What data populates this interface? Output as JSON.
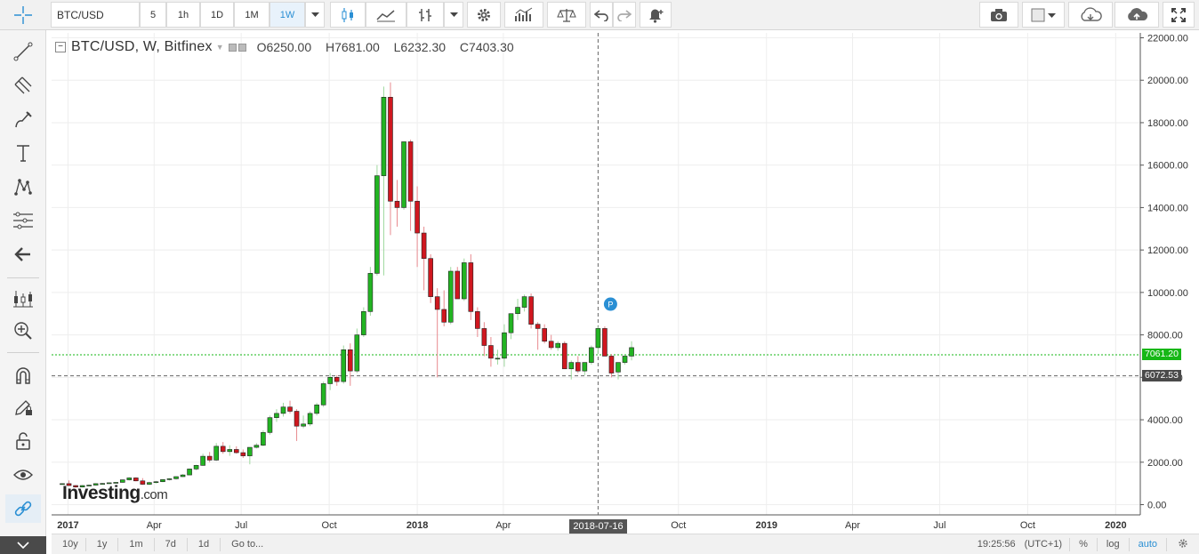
{
  "toolbar": {
    "symbol": "BTC/USD",
    "intervals": [
      "5",
      "1h",
      "1D",
      "1M",
      "1W"
    ],
    "active_interval": "1W"
  },
  "legend": {
    "symbol_line": "BTC/USD, W, Bitfinex",
    "open": "O6250.00",
    "high": "H7681.00",
    "low": "L6232.30",
    "close": "C7403.30"
  },
  "watermark": {
    "brand": "Investing",
    "suffix": ".com"
  },
  "price_tags": {
    "current": "7061.20",
    "crosshair": "6072.53"
  },
  "crosshair_time": "2018-07-16",
  "colors": {
    "up": "#22b422",
    "down": "#d0171f",
    "current_line": "#16b716",
    "marker": "#2a8fd4"
  },
  "marker_label": "P",
  "bottom": {
    "ranges": [
      "10y",
      "1y",
      "1m",
      "7d",
      "1d",
      "Go to..."
    ],
    "time": "19:25:56",
    "tz": "(UTC+1)",
    "pct": "%",
    "log": "log",
    "auto": "auto"
  },
  "chart_data": {
    "type": "candlestick",
    "y_ticks": [
      "22000.00",
      "20000.00",
      "18000.00",
      "16000.00",
      "14000.00",
      "12000.00",
      "10000.00",
      "8000.00",
      "6000.00",
      "4000.00",
      "2000.00",
      "0.00"
    ],
    "y_tick_values": [
      22000,
      20000,
      18000,
      16000,
      14000,
      12000,
      10000,
      8000,
      6000,
      4000,
      2000,
      0
    ],
    "x_ticks": [
      "2017",
      "Apr",
      "Jul",
      "Oct",
      "2018",
      "Apr",
      "Oct",
      "2019",
      "Apr",
      "Jul",
      "Oct",
      "2020"
    ],
    "x_tick_bold": [
      true,
      false,
      false,
      false,
      true,
      false,
      false,
      true,
      false,
      false,
      false,
      true
    ],
    "ylim": [
      0,
      22000
    ],
    "weeks_start": "2016-12-26",
    "candles": [
      {
        "o": 960,
        "h": 1000,
        "l": 940,
        "c": 990
      },
      {
        "o": 990,
        "h": 1140,
        "l": 880,
        "c": 900
      },
      {
        "o": 900,
        "h": 920,
        "l": 800,
        "c": 830
      },
      {
        "o": 830,
        "h": 920,
        "l": 810,
        "c": 900
      },
      {
        "o": 900,
        "h": 950,
        "l": 880,
        "c": 920
      },
      {
        "o": 920,
        "h": 1010,
        "l": 910,
        "c": 990
      },
      {
        "o": 990,
        "h": 1020,
        "l": 970,
        "c": 1000
      },
      {
        "o": 1000,
        "h": 1050,
        "l": 980,
        "c": 1030
      },
      {
        "o": 1030,
        "h": 1060,
        "l": 1000,
        "c": 1050
      },
      {
        "o": 1050,
        "h": 1180,
        "l": 1040,
        "c": 1170
      },
      {
        "o": 1170,
        "h": 1290,
        "l": 1140,
        "c": 1260
      },
      {
        "o": 1260,
        "h": 1290,
        "l": 1100,
        "c": 1120
      },
      {
        "o": 1120,
        "h": 1250,
        "l": 930,
        "c": 960
      },
      {
        "o": 960,
        "h": 1080,
        "l": 920,
        "c": 1040
      },
      {
        "o": 1040,
        "h": 1120,
        "l": 1000,
        "c": 1080
      },
      {
        "o": 1080,
        "h": 1200,
        "l": 1060,
        "c": 1180
      },
      {
        "o": 1180,
        "h": 1250,
        "l": 1140,
        "c": 1220
      },
      {
        "o": 1220,
        "h": 1330,
        "l": 1180,
        "c": 1320
      },
      {
        "o": 1320,
        "h": 1440,
        "l": 1300,
        "c": 1400
      },
      {
        "o": 1400,
        "h": 1700,
        "l": 1390,
        "c": 1680
      },
      {
        "o": 1680,
        "h": 1880,
        "l": 1620,
        "c": 1850
      },
      {
        "o": 1850,
        "h": 2400,
        "l": 1830,
        "c": 2280
      },
      {
        "o": 2280,
        "h": 2480,
        "l": 2000,
        "c": 2100
      },
      {
        "o": 2100,
        "h": 2900,
        "l": 2060,
        "c": 2750
      },
      {
        "o": 2750,
        "h": 2950,
        "l": 2400,
        "c": 2500
      },
      {
        "o": 2500,
        "h": 2800,
        "l": 2300,
        "c": 2600
      },
      {
        "o": 2600,
        "h": 2750,
        "l": 2400,
        "c": 2450
      },
      {
        "o": 2450,
        "h": 2600,
        "l": 2200,
        "c": 2300
      },
      {
        "o": 2300,
        "h": 2700,
        "l": 1900,
        "c": 2700
      },
      {
        "o": 2700,
        "h": 2900,
        "l": 2650,
        "c": 2800
      },
      {
        "o": 2800,
        "h": 3500,
        "l": 2750,
        "c": 3400
      },
      {
        "o": 3400,
        "h": 4200,
        "l": 3300,
        "c": 4100
      },
      {
        "o": 4100,
        "h": 4500,
        "l": 3900,
        "c": 4300
      },
      {
        "o": 4300,
        "h": 4800,
        "l": 4150,
        "c": 4600
      },
      {
        "o": 4600,
        "h": 4900,
        "l": 4300,
        "c": 4400
      },
      {
        "o": 4400,
        "h": 4500,
        "l": 3000,
        "c": 3700
      },
      {
        "o": 3700,
        "h": 4200,
        "l": 3600,
        "c": 3800
      },
      {
        "o": 3800,
        "h": 4400,
        "l": 3700,
        "c": 4300
      },
      {
        "o": 4300,
        "h": 4800,
        "l": 4200,
        "c": 4700
      },
      {
        "o": 4700,
        "h": 5800,
        "l": 4600,
        "c": 5700
      },
      {
        "o": 5700,
        "h": 6200,
        "l": 5400,
        "c": 6000
      },
      {
        "o": 6000,
        "h": 6100,
        "l": 5600,
        "c": 5800
      },
      {
        "o": 5800,
        "h": 7500,
        "l": 5700,
        "c": 7300
      },
      {
        "o": 7300,
        "h": 7600,
        "l": 5600,
        "c": 6300
      },
      {
        "o": 6300,
        "h": 8300,
        "l": 6200,
        "c": 8000
      },
      {
        "o": 8000,
        "h": 9300,
        "l": 7900,
        "c": 9100
      },
      {
        "o": 9100,
        "h": 11200,
        "l": 8900,
        "c": 10900
      },
      {
        "o": 10900,
        "h": 16000,
        "l": 10800,
        "c": 15500
      },
      {
        "o": 15500,
        "h": 19700,
        "l": 10800,
        "c": 19200
      },
      {
        "o": 19200,
        "h": 19900,
        "l": 12700,
        "c": 14300
      },
      {
        "o": 14300,
        "h": 15300,
        "l": 13100,
        "c": 14000
      },
      {
        "o": 14000,
        "h": 17100,
        "l": 13900,
        "c": 17100
      },
      {
        "o": 17100,
        "h": 17200,
        "l": 12900,
        "c": 14300
      },
      {
        "o": 14300,
        "h": 15000,
        "l": 11200,
        "c": 12800
      },
      {
        "o": 12800,
        "h": 13100,
        "l": 10100,
        "c": 11600
      },
      {
        "o": 11600,
        "h": 11800,
        "l": 9500,
        "c": 9800
      },
      {
        "o": 9800,
        "h": 10200,
        "l": 6000,
        "c": 9200
      },
      {
        "o": 9200,
        "h": 10100,
        "l": 8400,
        "c": 8600
      },
      {
        "o": 8600,
        "h": 11200,
        "l": 8500,
        "c": 11000
      },
      {
        "o": 11000,
        "h": 11200,
        "l": 9800,
        "c": 9700
      },
      {
        "o": 9700,
        "h": 11600,
        "l": 9600,
        "c": 11400
      },
      {
        "o": 11400,
        "h": 11800,
        "l": 8700,
        "c": 9100
      },
      {
        "o": 9100,
        "h": 9300,
        "l": 7900,
        "c": 8300
      },
      {
        "o": 8300,
        "h": 8600,
        "l": 7000,
        "c": 7500
      },
      {
        "o": 7500,
        "h": 7900,
        "l": 6500,
        "c": 6900
      },
      {
        "o": 6900,
        "h": 7300,
        "l": 6600,
        "c": 6900
      },
      {
        "o": 6900,
        "h": 8500,
        "l": 6500,
        "c": 8100
      },
      {
        "o": 8100,
        "h": 9000,
        "l": 7800,
        "c": 9000
      },
      {
        "o": 9000,
        "h": 9700,
        "l": 8700,
        "c": 9300
      },
      {
        "o": 9300,
        "h": 9900,
        "l": 9100,
        "c": 9800
      },
      {
        "o": 9800,
        "h": 9950,
        "l": 8300,
        "c": 8500
      },
      {
        "o": 8500,
        "h": 8600,
        "l": 7300,
        "c": 8300
      },
      {
        "o": 8300,
        "h": 8500,
        "l": 7600,
        "c": 7700
      },
      {
        "o": 7700,
        "h": 8000,
        "l": 7300,
        "c": 7400
      },
      {
        "o": 7400,
        "h": 7700,
        "l": 7250,
        "c": 7600
      },
      {
        "o": 7600,
        "h": 7700,
        "l": 6400,
        "c": 6400
      },
      {
        "o": 6400,
        "h": 6800,
        "l": 5900,
        "c": 6700
      },
      {
        "o": 6700,
        "h": 7000,
        "l": 6200,
        "c": 6300
      },
      {
        "o": 6300,
        "h": 6700,
        "l": 6100,
        "c": 6700
      },
      {
        "o": 6700,
        "h": 7500,
        "l": 6600,
        "c": 7400
      },
      {
        "o": 7400,
        "h": 8400,
        "l": 7100,
        "c": 8300
      },
      {
        "o": 8300,
        "h": 8400,
        "l": 7000,
        "c": 7000
      },
      {
        "o": 7000,
        "h": 7100,
        "l": 6000,
        "c": 6200
      },
      {
        "o": 6250,
        "h": 6700,
        "l": 5900,
        "c": 6700
      },
      {
        "o": 6700,
        "h": 7000,
        "l": 6600,
        "c": 7000
      },
      {
        "o": 7000,
        "h": 7700,
        "l": 6800,
        "c": 7400
      }
    ],
    "current_price": 7061.2,
    "crosshair_price": 6072.53,
    "crosshair_week_index": 80,
    "marker_week_index": 80
  }
}
